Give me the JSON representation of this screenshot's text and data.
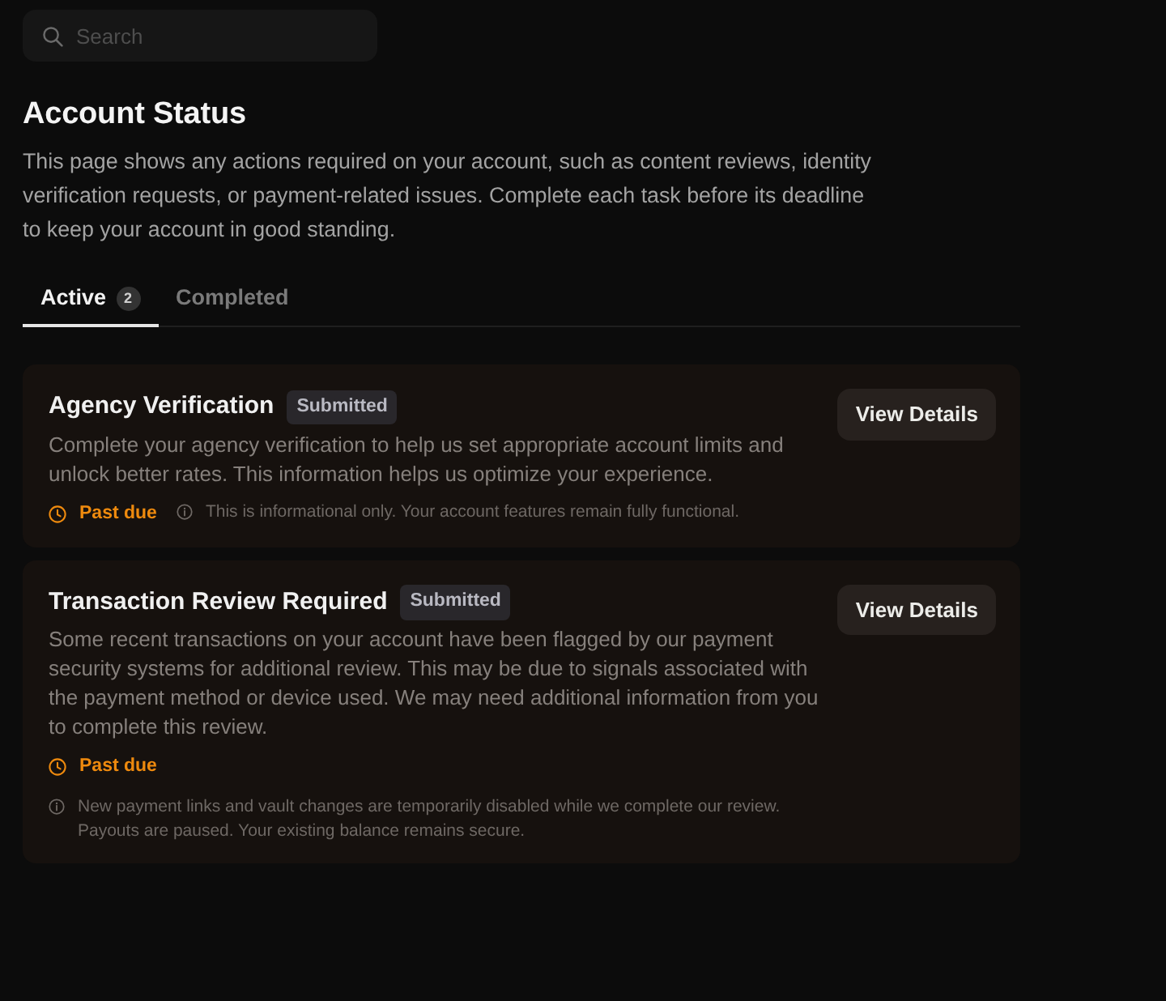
{
  "search": {
    "placeholder": "Search"
  },
  "page": {
    "title": "Account Status",
    "description": "This page shows any actions required on your account, such as content reviews, identity verification requests, or payment-related issues. Complete each task before its deadline to keep your account in good standing."
  },
  "tabs": [
    {
      "label": "Active",
      "count": "2",
      "selected": true
    },
    {
      "label": "Completed",
      "selected": false
    }
  ],
  "tasks": [
    {
      "title": "Agency Verification",
      "badge": "Submitted",
      "description": "Complete your agency verification to help us set appropriate account limits and unlock better rates. This information helps us optimize your experience.",
      "due": "Past due",
      "note": "This is informational only. Your account features remain fully functional.",
      "button": "View Details"
    },
    {
      "title": "Transaction Review Required",
      "badge": "Submitted",
      "description": "Some recent transactions on your account have been flagged by our payment security systems for additional review. This may be due to signals associated with the payment method or device used. We may need additional information from you to complete this review.",
      "due": "Past due",
      "note": "New payment links and vault changes are temporarily disabled while we complete our review. Payouts are paused. Your existing balance remains secure.",
      "button": "View Details"
    }
  ]
}
